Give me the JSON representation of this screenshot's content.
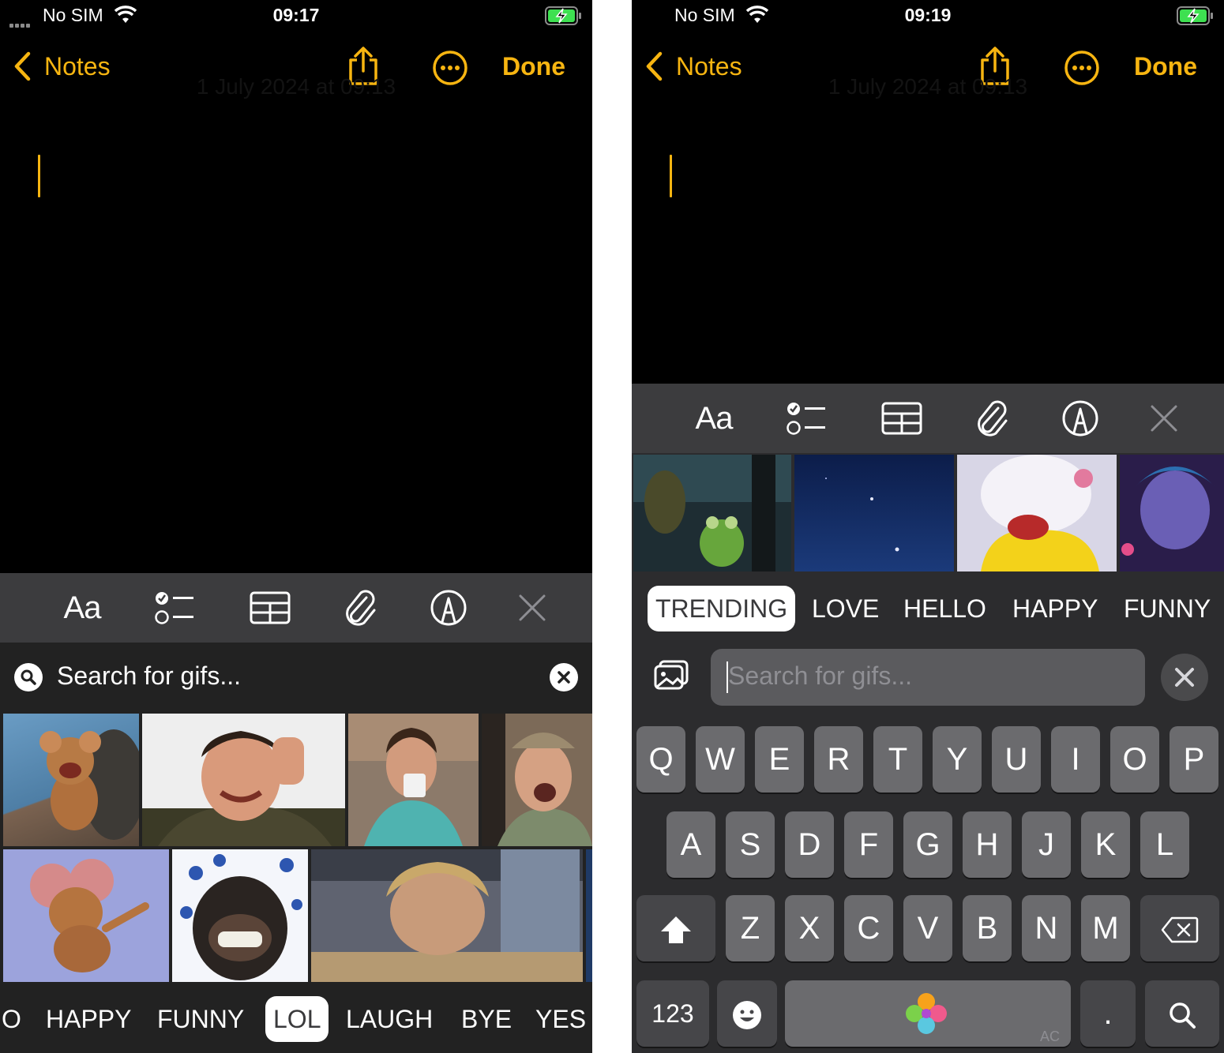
{
  "left": {
    "status": {
      "carrier": "No SIM",
      "time": "09:17"
    },
    "nav": {
      "back_label": "Notes",
      "done_label": "Done",
      "ghost_date": "1 July 2024 at 09:13"
    },
    "toolbar": {
      "format_label": "Aa"
    },
    "gif_search": {
      "placeholder": "Search for gifs..."
    },
    "categories": [
      "O",
      "HAPPY",
      "FUNNY",
      "LOL",
      "LAUGH",
      "BYE",
      "YES"
    ],
    "active_category": "LOL"
  },
  "right": {
    "status": {
      "carrier": "No SIM",
      "time": "09:19"
    },
    "nav": {
      "back_label": "Notes",
      "done_label": "Done",
      "ghost_date": "1 July 2024 at 09:13"
    },
    "toolbar": {
      "format_label": "Aa"
    },
    "categories": [
      "TRENDING",
      "LOVE",
      "HELLO",
      "HAPPY",
      "FUNNY"
    ],
    "active_category": "TRENDING",
    "gif_search": {
      "placeholder": "Search for gifs..."
    },
    "keyboard": {
      "row1": [
        "Q",
        "W",
        "E",
        "R",
        "T",
        "Y",
        "U",
        "I",
        "O",
        "P"
      ],
      "row2": [
        "A",
        "S",
        "D",
        "F",
        "G",
        "H",
        "J",
        "K",
        "L"
      ],
      "row3": [
        "Z",
        "X",
        "C",
        "V",
        "B",
        "N",
        "M"
      ],
      "numbers_label": "123",
      "period_label": ".",
      "space_badge": "AC"
    }
  },
  "colors": {
    "accent": "#f7b511",
    "toolbar_bg": "#3c3c3e",
    "keyboard_bg": "#2c2c2e",
    "key_bg": "#6b6b6e",
    "battery_green": "#3ee051"
  }
}
